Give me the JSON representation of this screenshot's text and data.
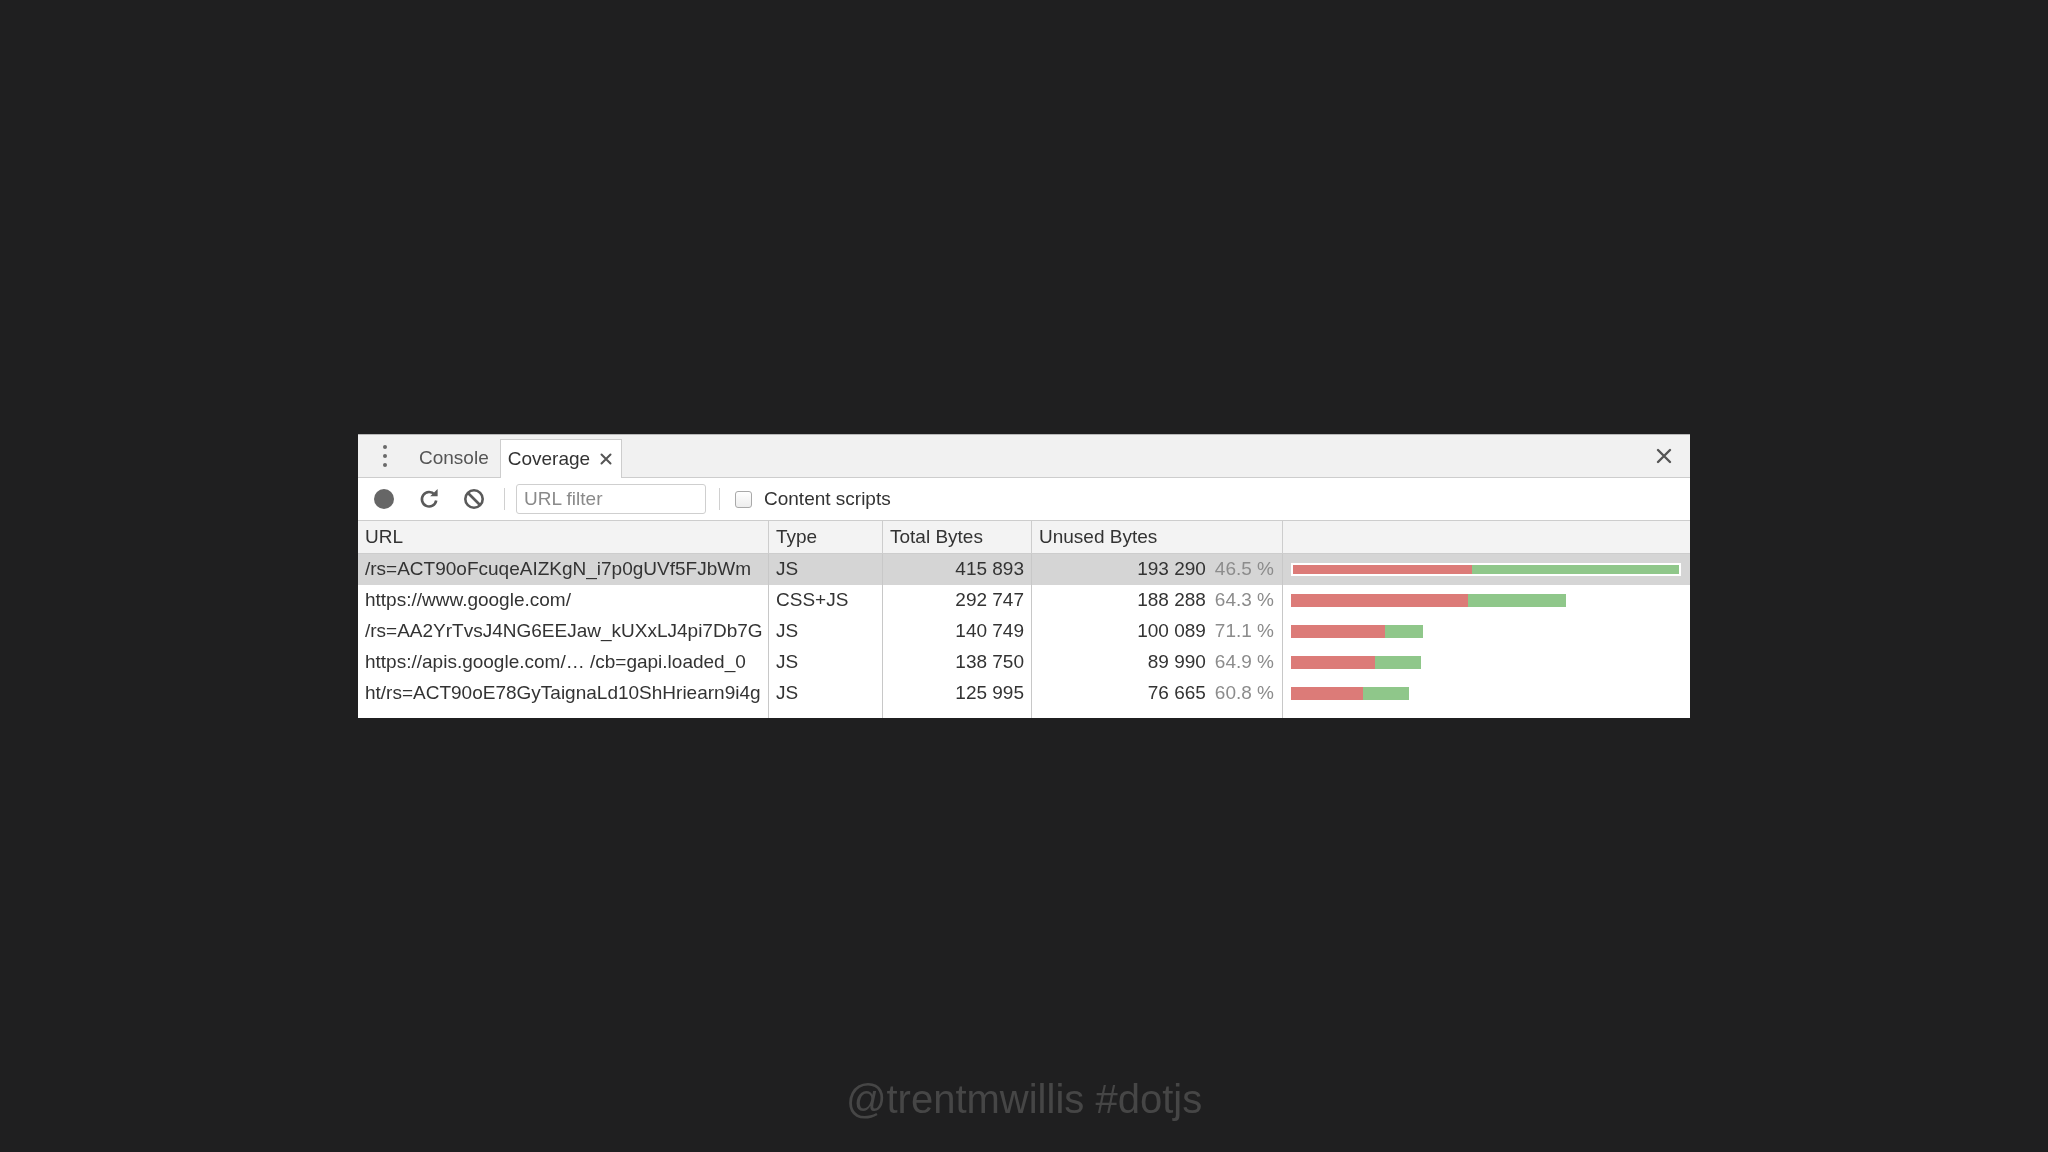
{
  "panel": {
    "tabs": [
      {
        "label": "Console",
        "selected": false,
        "closable": false
      },
      {
        "label": "Coverage",
        "selected": true,
        "closable": true
      }
    ],
    "toolbar": {
      "url_filter": {
        "placeholder": "URL filter"
      },
      "content_scripts": {
        "label": "Content scripts",
        "checked": false
      }
    },
    "table": {
      "columns": [
        "URL",
        "Type",
        "Total Bytes",
        "Unused Bytes"
      ],
      "rows": [
        {
          "url": "/rs=ACT90oFcuqeAIZKgN_i7p0gUVf5FJbWm",
          "type": "JS",
          "total_bytes": "415 893",
          "unused_bytes": "193 290",
          "unused_percent": "46.5 %",
          "selected": true
        },
        {
          "url": "https://www.google.com/",
          "type": "CSS+JS",
          "total_bytes": "292 747",
          "unused_bytes": "188 288",
          "unused_percent": "64.3 %",
          "selected": false
        },
        {
          "url": "/rs=AA2YrTvsJ4NG6EEJaw_kUXxLJ4pi7Db7G",
          "type": "JS",
          "total_bytes": "140 749",
          "unused_bytes": "100 089",
          "unused_percent": "71.1 %",
          "selected": false
        },
        {
          "url": "https://apis.google.com/… /cb=gapi.loaded_0",
          "type": "JS",
          "total_bytes": "138 750",
          "unused_bytes": "89 990",
          "unused_percent": "64.9 %",
          "selected": false
        },
        {
          "url": "ht/rs=ACT90oE78GyTaignaLd10ShHriearn9i4g",
          "type": "JS",
          "total_bytes": "125 995",
          "unused_bytes": "76 665",
          "unused_percent": "60.8 %",
          "selected": false
        }
      ]
    }
  },
  "slide_caption": "@trentmwillis #dotjs"
}
